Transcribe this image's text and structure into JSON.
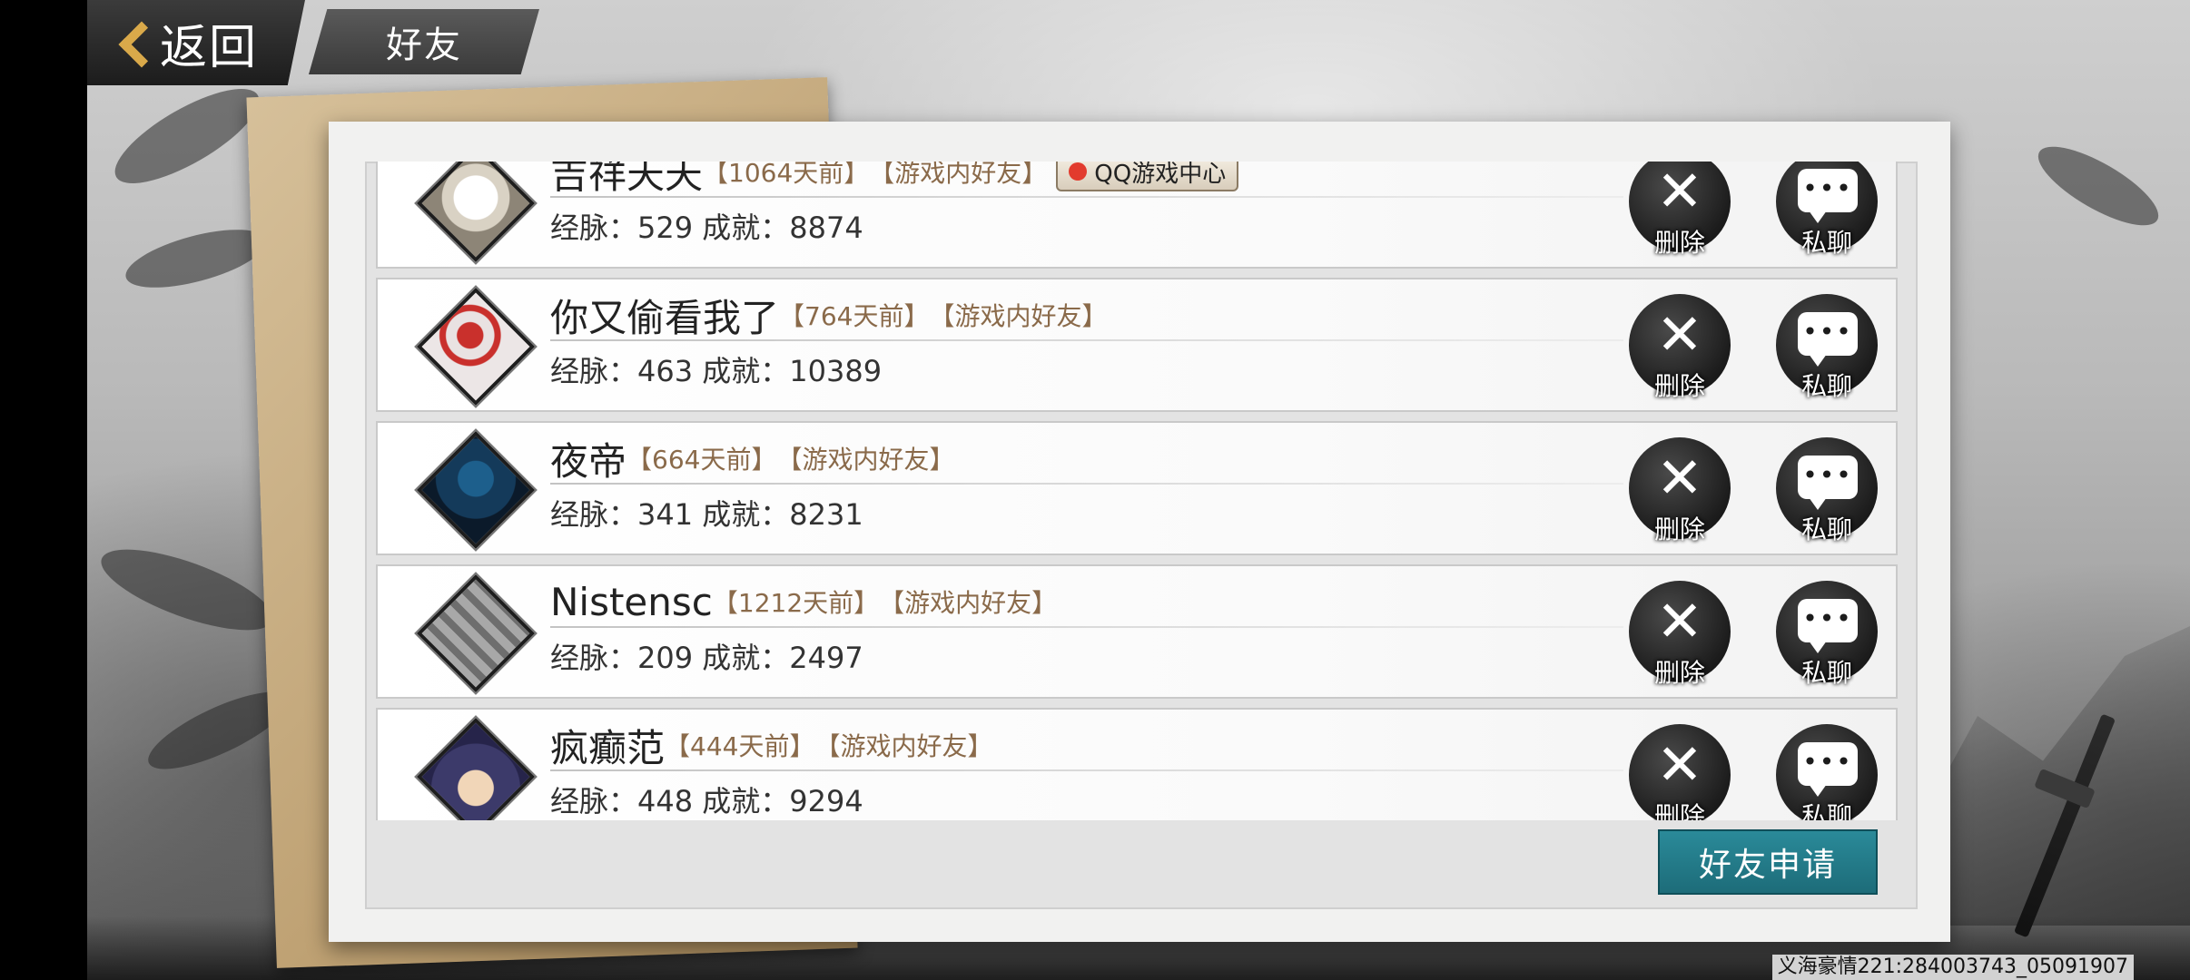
{
  "nav": {
    "back_label": "返回",
    "title": "好友"
  },
  "friends": [
    {
      "name": "吉祥天天",
      "days": "【1064天前】",
      "source": "【游戏内好友】",
      "badge": "QQ游戏中心",
      "stats": "经脉：529 成就：8874",
      "avatar": "cat-avatar"
    },
    {
      "name": "你又偷看我了",
      "days": "【764天前】",
      "source": "【游戏内好友】",
      "stats": "经脉：463 成就：10389",
      "avatar": "red-blur-avatar"
    },
    {
      "name": "夜帝",
      "days": "【664天前】",
      "source": "【游戏内好友】",
      "stats": "经脉：341 成就：8231",
      "avatar": "dark-figure-avatar"
    },
    {
      "name": "Nistensc",
      "days": "【1212天前】",
      "source": "【游戏内好友】",
      "stats": "经脉：209 成就：2497",
      "avatar": "symbol-avatar"
    },
    {
      "name": "疯癫范",
      "days": "【444天前】",
      "source": "【游戏内好友】",
      "stats": "经脉：448 成就：9294",
      "avatar": "anime-avatar"
    }
  ],
  "actions": {
    "delete_label": "删除",
    "chat_label": "私聊"
  },
  "request_button": "好友申请",
  "footer_id": "义海豪情221:284003743_05091907",
  "colors": {
    "accent": "#1d6c79",
    "tag": "#8a6a4a"
  }
}
